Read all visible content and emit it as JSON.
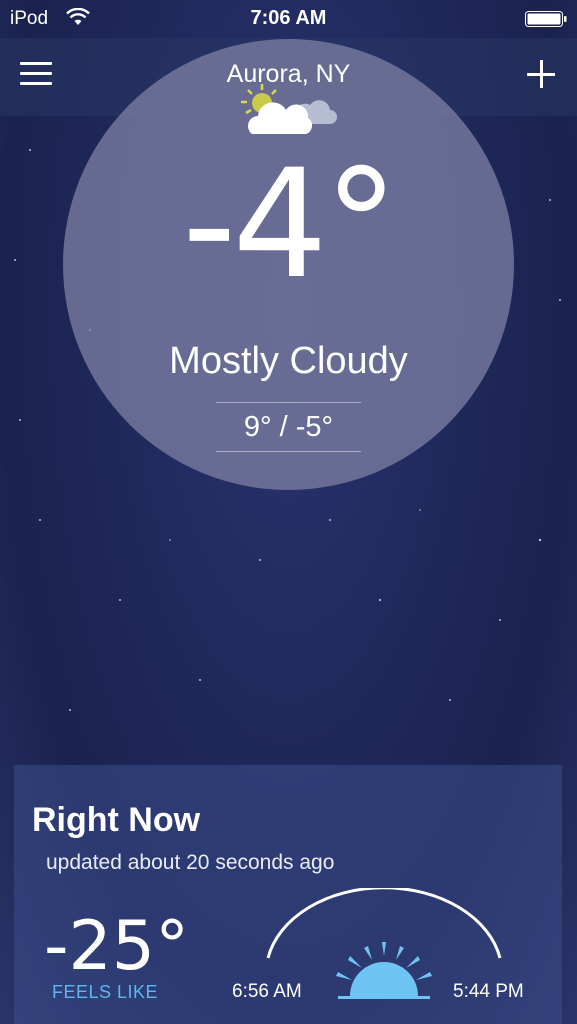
{
  "status_bar": {
    "carrier": "iPod",
    "time": "7:06 AM"
  },
  "header": {
    "location": "Aurora, NY"
  },
  "current": {
    "icon": "partly-cloudy-icon",
    "temperature": "-4°",
    "condition": "Mostly Cloudy",
    "hi_lo": "9° / -5°"
  },
  "right_now": {
    "title": "Right Now",
    "updated": "updated about 20 seconds ago",
    "feels_like_temp": "-25°",
    "feels_like_label": "FEELS LIKE",
    "sunrise": "6:56 AM",
    "sunset": "5:44 PM"
  },
  "colors": {
    "accent": "#5cb8ef",
    "sun": "#6ec4f2"
  }
}
